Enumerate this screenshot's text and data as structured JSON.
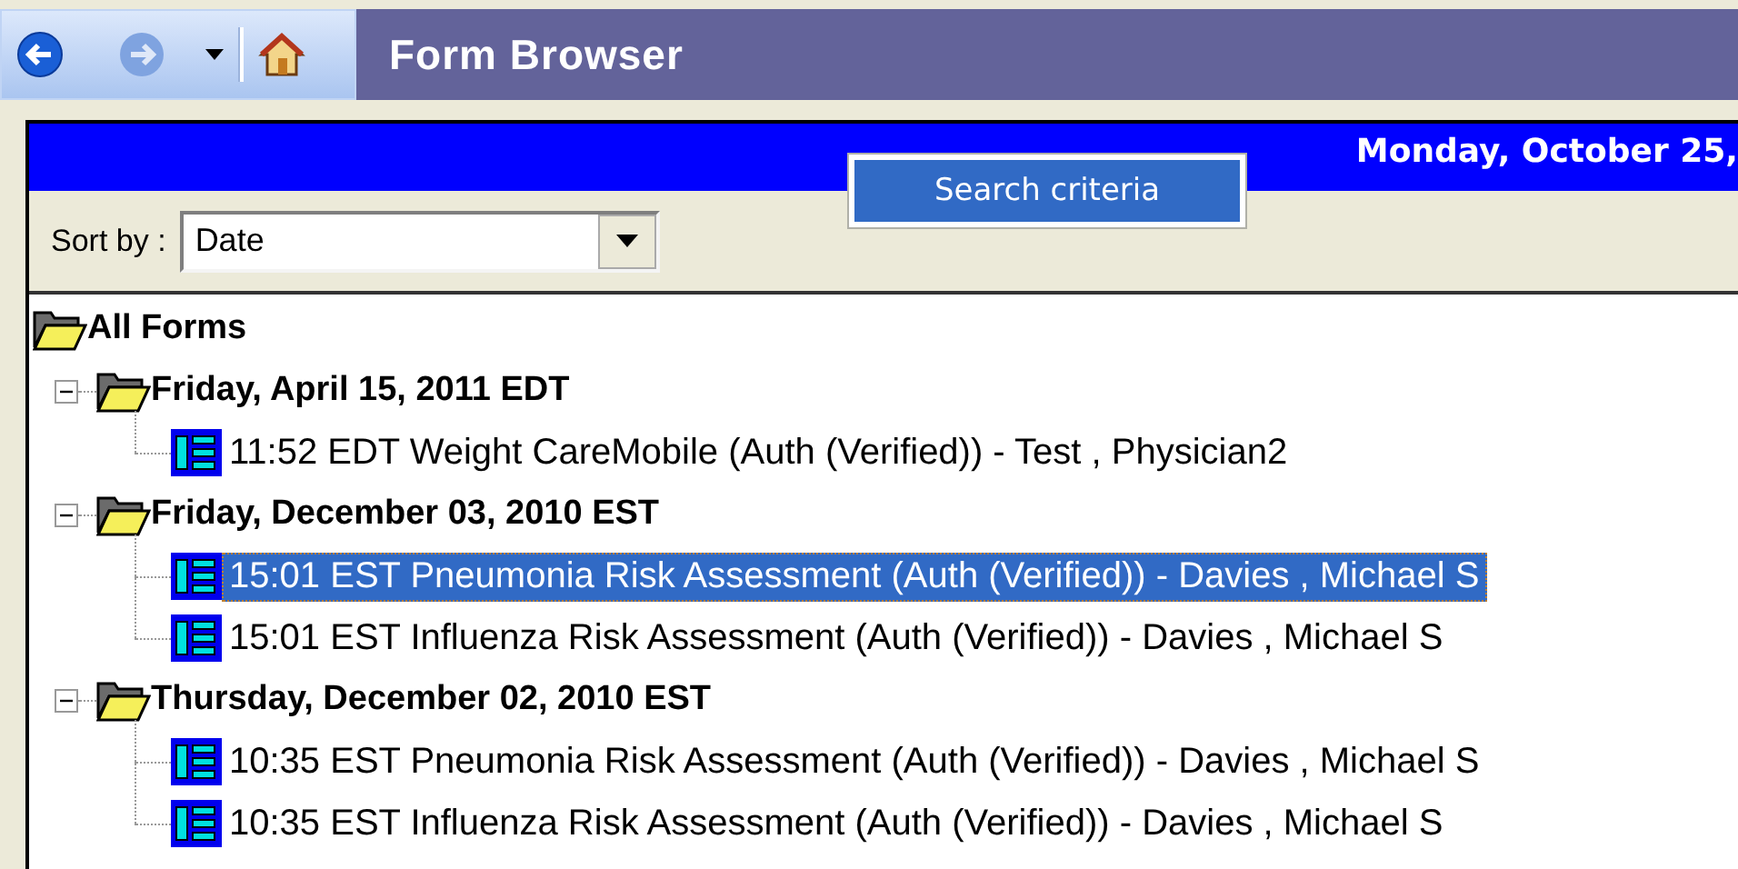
{
  "toolbar": {
    "title": "Form Browser"
  },
  "header": {
    "date": "Monday, October 25,"
  },
  "search_button": {
    "label": "Search criteria"
  },
  "sort": {
    "label": "Sort by :",
    "value": "Date"
  },
  "tree": {
    "label": "All Forms",
    "children": [
      {
        "label": "Friday, April 15, 2011 EDT",
        "expanded": true,
        "children": [
          {
            "label": "11:52 EDT Weight CareMobile (Auth (Verified)) - Test , Physician2",
            "selected": false
          }
        ]
      },
      {
        "label": "Friday, December 03, 2010 EST",
        "expanded": true,
        "children": [
          {
            "label": "15:01 EST Pneumonia Risk Assessment (Auth (Verified)) - Davies , Michael S",
            "selected": true
          },
          {
            "label": "15:01 EST Influenza Risk Assessment (Auth (Verified)) - Davies , Michael S",
            "selected": false
          }
        ]
      },
      {
        "label": "Thursday, December 02, 2010 EST",
        "expanded": true,
        "children": [
          {
            "label": "10:35 EST Pneumonia Risk Assessment (Auth (Verified)) - Davies , Michael S",
            "selected": false
          },
          {
            "label": "10:35 EST Influenza Risk Assessment (Auth (Verified)) - Davies , Michael S",
            "selected": false
          }
        ]
      }
    ]
  }
}
